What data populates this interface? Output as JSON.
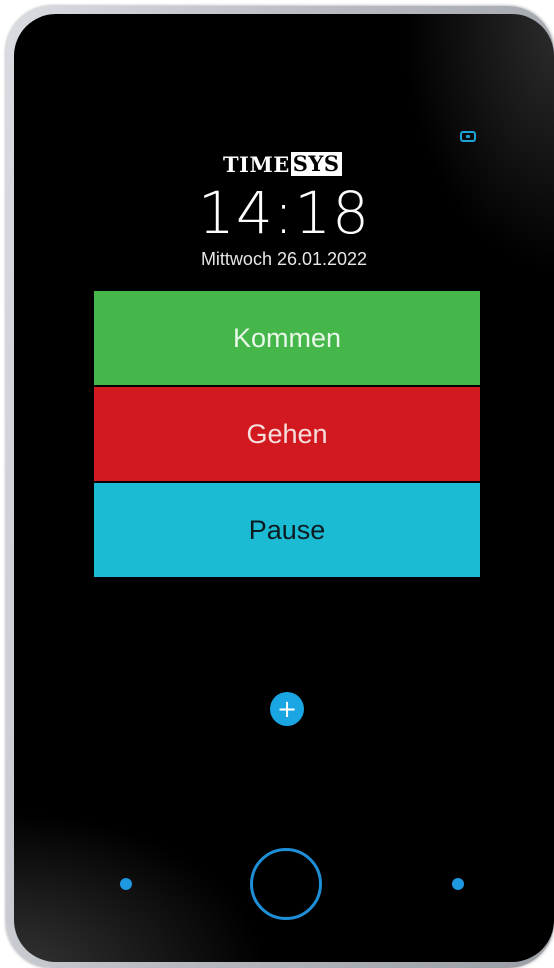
{
  "brand": {
    "logo_part1": "TIME",
    "logo_part2": "SYS"
  },
  "clock": {
    "time": "14:18",
    "date": "Mittwoch 26.01.2022"
  },
  "actions": {
    "kommen_label": "Kommen",
    "gehen_label": "Gehen",
    "pause_label": "Pause"
  },
  "controls": {
    "plus_symbol": "+"
  },
  "colors": {
    "kommen": "#45b64a",
    "gehen": "#d2191f",
    "pause": "#1bbcd3",
    "accent": "#1aa6e2"
  },
  "icons": {
    "top_right": "camera-icon",
    "add": "plus-icon",
    "home": "home-button-icon",
    "left_indicator": "dot-icon",
    "right_indicator": "dot-icon"
  }
}
